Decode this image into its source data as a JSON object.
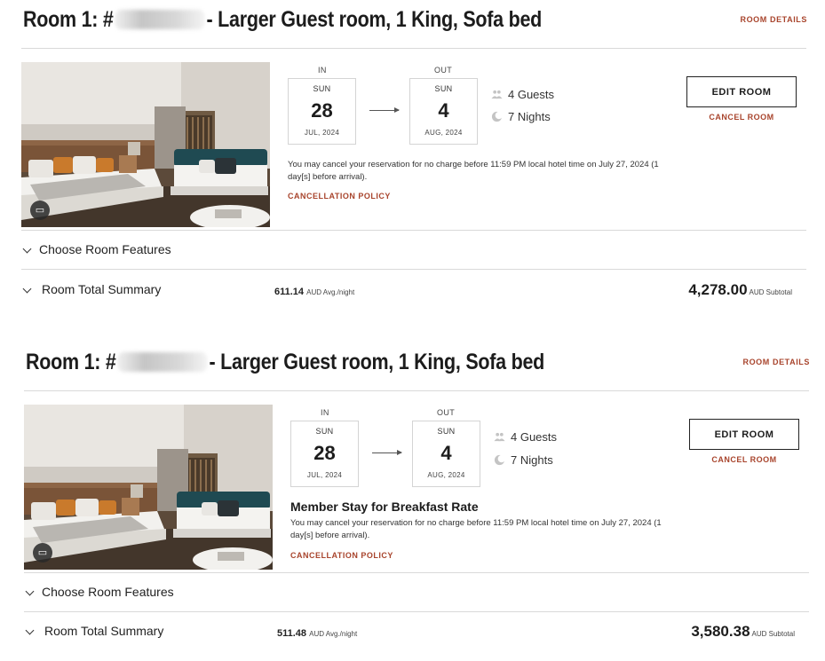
{
  "rooms": [
    {
      "title_prefix": "Room 1: #",
      "title_suffix": "- Larger Guest room, 1 King, Sofa bed",
      "room_details": "ROOM DETAILS",
      "check_in": {
        "label": "IN",
        "dow": "SUN",
        "day": "28",
        "month_year": "JUL, 2024"
      },
      "check_out": {
        "label": "OUT",
        "dow": "SUN",
        "day": "4",
        "month_year": "AUG, 2024"
      },
      "guests": "4 Guests",
      "nights": "7 Nights",
      "edit_room": "EDIT ROOM",
      "cancel_room": "CANCEL ROOM",
      "rate_name": "",
      "cancel_text": "You may cancel your reservation for no charge before 11:59 PM local hotel time on July 27, 2024 (1 day[s] before arrival).",
      "cancellation_policy": "CANCELLATION POLICY",
      "choose_features": "Choose Room Features",
      "total_summary": "Room Total Summary",
      "avg_amount": "611.14",
      "avg_unit": "AUD Avg./night",
      "subtotal_amount": "4,278.00",
      "subtotal_unit": "AUD Subtotal"
    },
    {
      "title_prefix": "Room 1: #",
      "title_suffix": "- Larger Guest room, 1 King, Sofa bed",
      "room_details": "ROOM DETAILS",
      "check_in": {
        "label": "IN",
        "dow": "SUN",
        "day": "28",
        "month_year": "JUL, 2024"
      },
      "check_out": {
        "label": "OUT",
        "dow": "SUN",
        "day": "4",
        "month_year": "AUG, 2024"
      },
      "guests": "4 Guests",
      "nights": "7 Nights",
      "edit_room": "EDIT ROOM",
      "cancel_room": "CANCEL ROOM",
      "rate_name": "Member Stay for Breakfast Rate",
      "cancel_text": "You may cancel your reservation for no charge before 11:59 PM local hotel time on July 27, 2024 (1 day[s] before arrival).",
      "cancellation_policy": "CANCELLATION POLICY",
      "choose_features": "Choose Room Features",
      "total_summary": "Room Total Summary",
      "avg_amount": "511.48",
      "avg_unit": "AUD Avg./night",
      "subtotal_amount": "3,580.38",
      "subtotal_unit": "AUD Subtotal"
    }
  ],
  "colors": {
    "accent": "#a8442c",
    "divider": "#d9d9d9",
    "text": "#1c1c1c"
  },
  "icons": {
    "guests": "people-icon",
    "nights": "moon-icon",
    "gallery": "gallery-icon",
    "expand": "chevron-down-icon"
  }
}
